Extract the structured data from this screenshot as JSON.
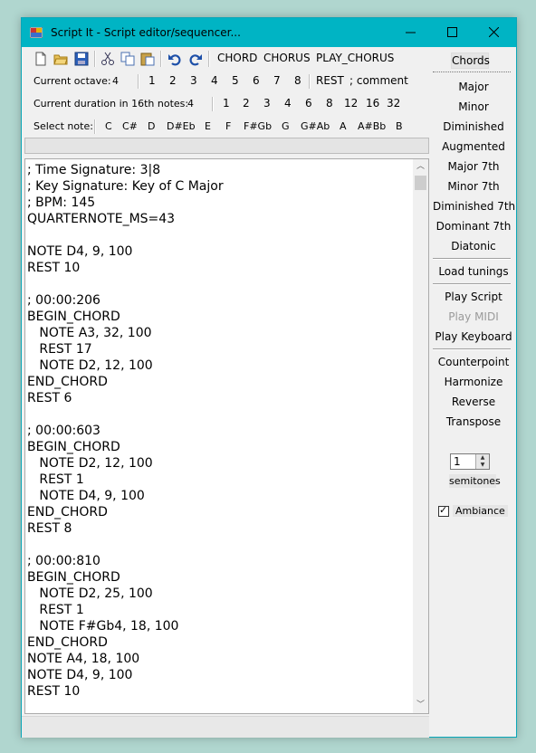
{
  "window": {
    "title": "Script It - Script editor/sequencer...",
    "minimize_glyph": "—",
    "maximize_glyph": "☐",
    "close_glyph": "✕"
  },
  "toolbar": {
    "icons": [
      "new-file-icon",
      "open-folder-icon",
      "save-icon",
      "cut-icon",
      "copy-icon",
      "paste-icon",
      "undo-icon",
      "redo-icon"
    ],
    "buttons": [
      "CHORD",
      "CHORUS",
      "PLAY_CHORUS"
    ]
  },
  "octave_bar": {
    "label": "Current octave:",
    "value": "4",
    "options": [
      "1",
      "2",
      "3",
      "4",
      "5",
      "6",
      "7",
      "8"
    ],
    "rest": "REST",
    "comment": "; comment"
  },
  "duration_bar": {
    "label": "Current duration in 16th notes:",
    "value": "4",
    "options": [
      "1",
      "2",
      "3",
      "4",
      "6",
      "8",
      "12",
      "16",
      "32"
    ]
  },
  "note_bar": {
    "label": "Select note:",
    "notes": [
      "C",
      "C#",
      "D",
      "D#Eb",
      "E",
      "F",
      "F#Gb",
      "G",
      "G#Ab",
      "A",
      "A#Bb",
      "B"
    ]
  },
  "editor": {
    "lines": [
      "; Time Signature: 3|8",
      "; Key Signature: Key of C Major",
      "; BPM: 145",
      "QUARTERNOTE_MS=43",
      "",
      "NOTE D4, 9, 100",
      "REST 10",
      "",
      "; 00:00:206",
      "BEGIN_CHORD",
      "   NOTE A3, 32, 100",
      "   REST 17",
      "   NOTE D2, 12, 100",
      "END_CHORD",
      "REST 6",
      "",
      "; 00:00:603",
      "BEGIN_CHORD",
      "   NOTE D2, 12, 100",
      "   REST 1",
      "   NOTE D4, 9, 100",
      "END_CHORD",
      "REST 8",
      "",
      "; 00:00:810",
      "BEGIN_CHORD",
      "   NOTE D2, 25, 100",
      "   REST 1",
      "   NOTE F#Gb4, 18, 100",
      "END_CHORD",
      "NOTE A4, 18, 100",
      "NOTE D4, 9, 100",
      "REST 10"
    ]
  },
  "right_panel": {
    "chords_label": "Chords",
    "chord_buttons": [
      "Major",
      "Minor",
      "Diminished",
      "Augmented",
      "Major 7th",
      "Minor 7th",
      "Diminished 7th",
      "Dominant 7th",
      "Diatonic"
    ],
    "load_tunings": "Load tunings",
    "play_script": "Play Script",
    "play_midi": "Play MIDI",
    "play_keyboard": "Play Keyboard",
    "counterpoint": "Counterpoint",
    "harmonize": "Harmonize",
    "reverse": "Reverse",
    "transpose": "Transpose",
    "transpose_value": "1",
    "semitones": "semitones",
    "ambiance_checked": true,
    "ambiance": "Ambiance",
    "check_glyph": "✓"
  }
}
